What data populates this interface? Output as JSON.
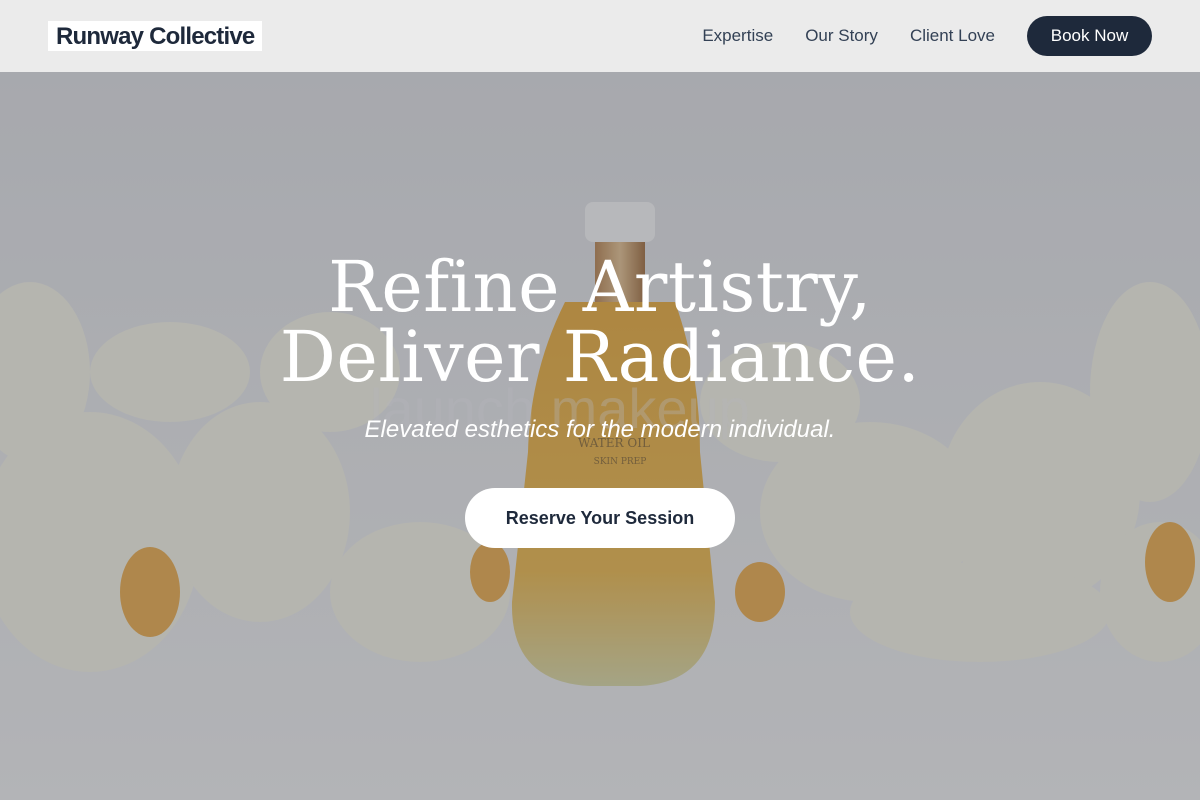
{
  "header": {
    "logo": "Runway Collective",
    "nav": [
      {
        "label": "Expertise"
      },
      {
        "label": "Our Story"
      },
      {
        "label": "Client Love"
      }
    ],
    "cta_label": "Book Now"
  },
  "hero": {
    "title": "Refine Artistry, Deliver Radiance.",
    "subtitle": "Elevated esthetics for the modern individual.",
    "cta_label": "Reserve Your Session",
    "background_watermark": "launch makeup"
  },
  "colors": {
    "primary": "#1e293b",
    "header_bg": "#ebebeb",
    "overlay": "rgba(70,72,80,0.35)"
  }
}
